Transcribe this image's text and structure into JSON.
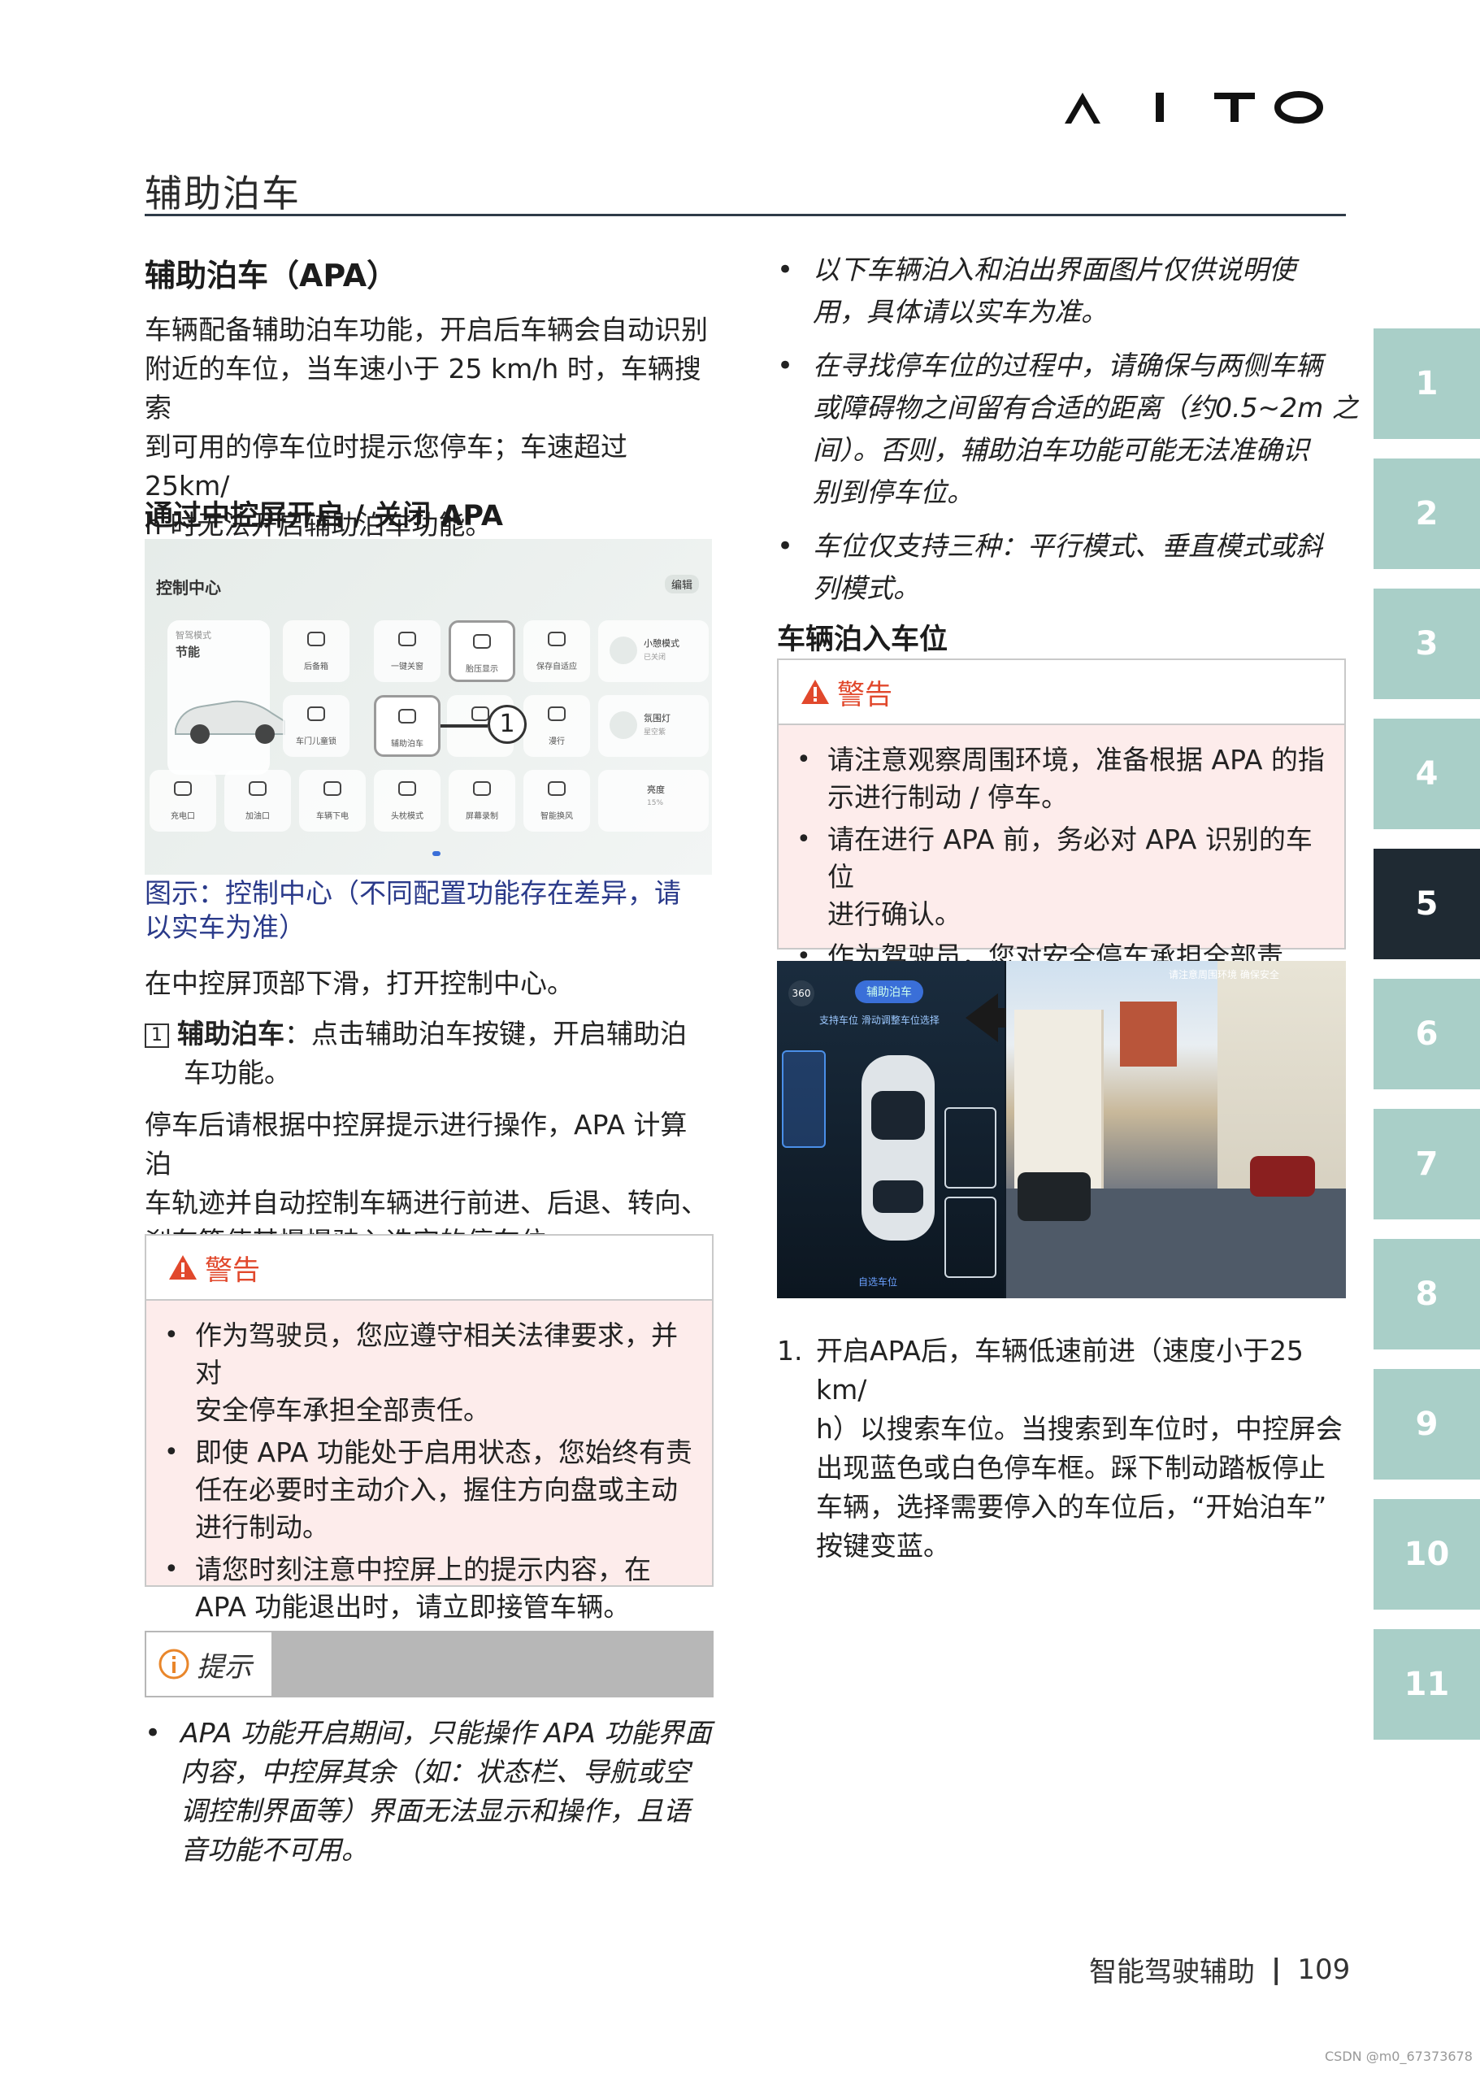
{
  "header": {
    "brand": "AITO",
    "page_title": "辅助泊车"
  },
  "left": {
    "heading": "辅助泊车（APA）",
    "intro": [
      "车辆配备辅助泊车功能，开启后车辆会自动识别",
      "附近的车位，当车速小于 25 km/h 时，车辆搜索",
      "到可用的停车位时提示您停车；车速超过 25km/",
      "h 时无法开启辅助泊车功能。"
    ],
    "sub_heading": "通过中控屏开启 / 关闭 APA",
    "screen": {
      "title": "控制中心",
      "edit": "编辑",
      "car_mode_small": "智驾模式",
      "car_mode": "节能",
      "row1": [
        "后备箱",
        "一键关窗",
        "胎压显示",
        "保存自适应",
        "小憩模式"
      ],
      "row1_sub": "已关闭",
      "row2": [
        "车门儿童锁",
        "辅助泊车",
        "",
        "漫行",
        "氛围灯"
      ],
      "row2_sub": "星空紫",
      "row3": [
        "充电口",
        "加油口",
        "车辆下电",
        "头枕模式",
        "屏幕录制",
        "智能换风",
        "亮度"
      ],
      "brightness": "15%",
      "callout": "1"
    },
    "caption": [
      "图示：控制中心（不同配置功能存在差异，请",
      "以实车为准）"
    ],
    "step_open": "在中控屏顶部下滑，打开控制中心。",
    "item1": {
      "num": "1",
      "label": "辅助泊车",
      "text1": "：点击辅助泊车按键，开启辅助泊",
      "text2": "车功能。"
    },
    "after": [
      "停车后请根据中控屏提示进行操作，APA 计算泊",
      "车轨迹并自动控制车辆进行前进、后退、转向、",
      "刹车等使其慢慢驶入选定的停车位。"
    ],
    "warning": {
      "title": "警告",
      "items": [
        [
          "作为驾驶员，您应遵守相关法律要求，并对",
          "安全停车承担全部责任。"
        ],
        [
          "即使 APA 功能处于启用状态，您始终有责",
          "任在必要时主动介入，握住方向盘或主动",
          "进行制动。"
        ],
        [
          "请您时刻注意中控屏上的提示内容，在",
          "APA 功能退出时，请立即接管车辆。"
        ]
      ]
    },
    "tip": {
      "title": "提示",
      "text": [
        "APA 功能开启期间，只能操作 APA 功能界面",
        "内容，中控屏其余（如：状态栏、导航或空",
        "调控制界面等）界面无法显示和操作，且语",
        "音功能不可用。"
      ]
    }
  },
  "right": {
    "bullets": [
      [
        "以下车辆泊入和泊出界面图片仅供说明使",
        "用，具体请以实车为准。"
      ],
      [
        "在寻找停车位的过程中，请确保与两侧车辆",
        "或障碍物之间留有合适的距离（约0.5~2m 之",
        "间）。否则，辅助泊车功能可能无法准确识",
        "别到停车位。"
      ],
      [
        "车位仅支持三种：平行模式、垂直模式或斜",
        "列模式。"
      ]
    ],
    "heading": "车辆泊入车位",
    "warning": {
      "title": "警告",
      "items": [
        [
          "请注意观察周围环境，准备根据 APA 的指",
          "示进行制动 / 停车。"
        ],
        [
          "请在进行 APA 前，务必对 APA 识别的车位",
          "进行确认。"
        ],
        [
          "作为驾驶员，您对安全停车承担全部责任。"
        ]
      ]
    },
    "parking": {
      "badge": "360",
      "pill": "辅助泊车",
      "hint": "支持车位  滑动调整车位选择",
      "top_hint": "请注意周围环境  确保安全",
      "bottom": "自选车位"
    },
    "step1": {
      "num": "1.",
      "lines": [
        "开启APA后，车辆低速前进（速度小于25 km/",
        "h）以搜索车位。当搜索到车位时，中控屏会",
        "出现蓝色或白色停车框。踩下制动踏板停止",
        "车辆，选择需要停入的车位后，“开始泊车”",
        "按键变蓝。"
      ]
    }
  },
  "tabs": [
    "1",
    "2",
    "3",
    "4",
    "5",
    "6",
    "7",
    "8",
    "9",
    "10",
    "11"
  ],
  "active_tab": "5",
  "footer": {
    "section": "智能驾驶辅助",
    "sep": "|",
    "page": "109",
    "watermark": "CSDN @m0_67373678"
  }
}
